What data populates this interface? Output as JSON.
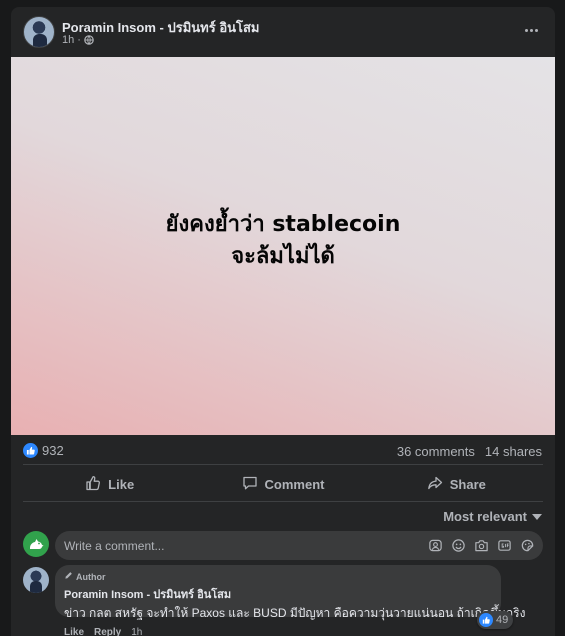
{
  "post": {
    "author": "Poramin Insom - ปรมินทร์ อินโสม",
    "time": "1h ·",
    "image_lines": [
      "ยังคงย้ำว่า stablecoin",
      "จะล้มไม่ได้"
    ]
  },
  "stats": {
    "likes": "932",
    "comments": "36 comments",
    "shares": "14 shares"
  },
  "actions": {
    "like": "Like",
    "comment": "Comment",
    "share": "Share"
  },
  "sort": {
    "label": "Most relevant"
  },
  "composer": {
    "placeholder": "Write a comment..."
  },
  "comment": {
    "badge": "Author",
    "author": "Poramin Insom - ปรมินทร์ อินโสม",
    "text": "ข่าว กลต สหรัฐ จะทำให้ Paxos และ BUSD มีปัญหา คือความวุ่นวายแน่นอน ถ้าเกิดขึ้นจริง",
    "reactions": "49",
    "like": "Like",
    "reply": "Reply",
    "time": "1h"
  },
  "colors": {
    "background": "#18191a",
    "card": "#242526",
    "accent": "#2d88ff",
    "text": "#e4e6eb",
    "muted": "#b0b3b8"
  }
}
